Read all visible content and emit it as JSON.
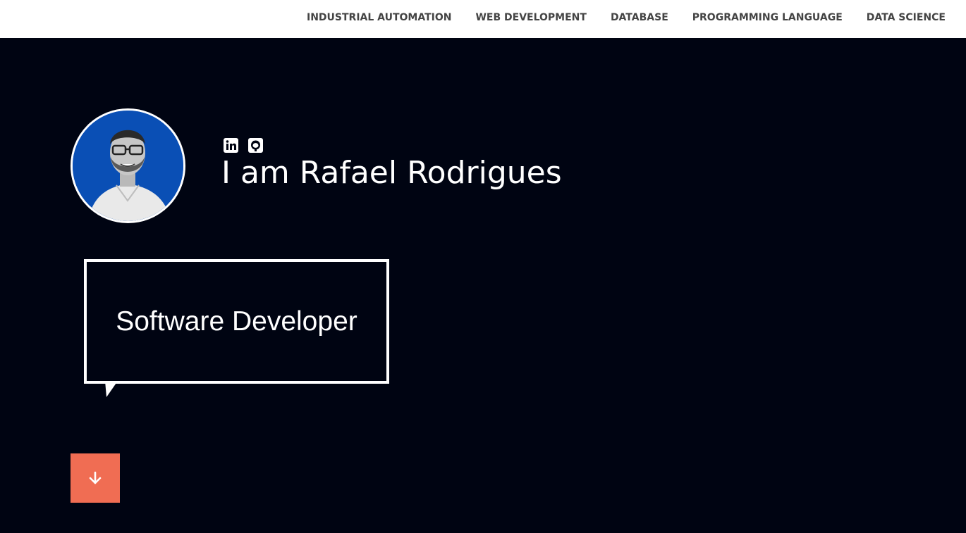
{
  "nav": {
    "items": [
      {
        "label": "INDUSTRIAL AUTOMATION"
      },
      {
        "label": "WEB DEVELOPMENT"
      },
      {
        "label": "DATABASE"
      },
      {
        "label": "PROGRAMMING LANGUAGE"
      },
      {
        "label": "DATA SCIENCE"
      }
    ]
  },
  "hero": {
    "social": [
      "linkedin-icon",
      "github-icon"
    ],
    "name": "I am Rafael Rodrigues",
    "role": "Software Developer",
    "scroll_icon": "arrow-down-icon"
  },
  "colors": {
    "background": "#000412",
    "accent": "#f06d53",
    "avatar_bg": "#0a4fb5",
    "nav_text": "#444444"
  }
}
